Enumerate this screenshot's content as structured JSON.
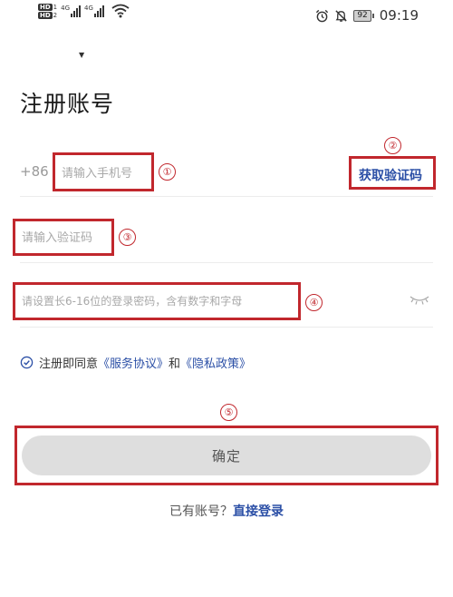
{
  "status_bar": {
    "hd1": "HD",
    "hd1_sub": "1",
    "hd2": "HD",
    "hd2_sub": "2",
    "net1": "4G",
    "net2": "4G",
    "battery": "92",
    "time": "09:19"
  },
  "page": {
    "title": "注册账号"
  },
  "form": {
    "country_code": "+86",
    "phone_placeholder": "请输入手机号",
    "get_code_label": "获取验证码",
    "code_placeholder": "请输入验证码",
    "password_placeholder": "请设置长6-16位的登录密码，含有数字和字母"
  },
  "agreement": {
    "prefix": "注册即同意",
    "service_link": "《服务协议》",
    "conjunction": "和",
    "privacy_link": "《隐私政策》"
  },
  "actions": {
    "confirm_label": "确定",
    "have_account": "已有账号？",
    "login_link": "直接登录"
  },
  "annotations": [
    "①",
    "②",
    "③",
    "④",
    "⑤"
  ],
  "colors": {
    "annotation_red": "#c1272d",
    "link_blue": "#2b4fa6",
    "button_gray": "#dedede"
  },
  "icons": [
    "wifi-icon",
    "alarm-icon",
    "mute-bell-icon",
    "battery-icon",
    "eye-closed-icon",
    "check-circle-icon"
  ]
}
